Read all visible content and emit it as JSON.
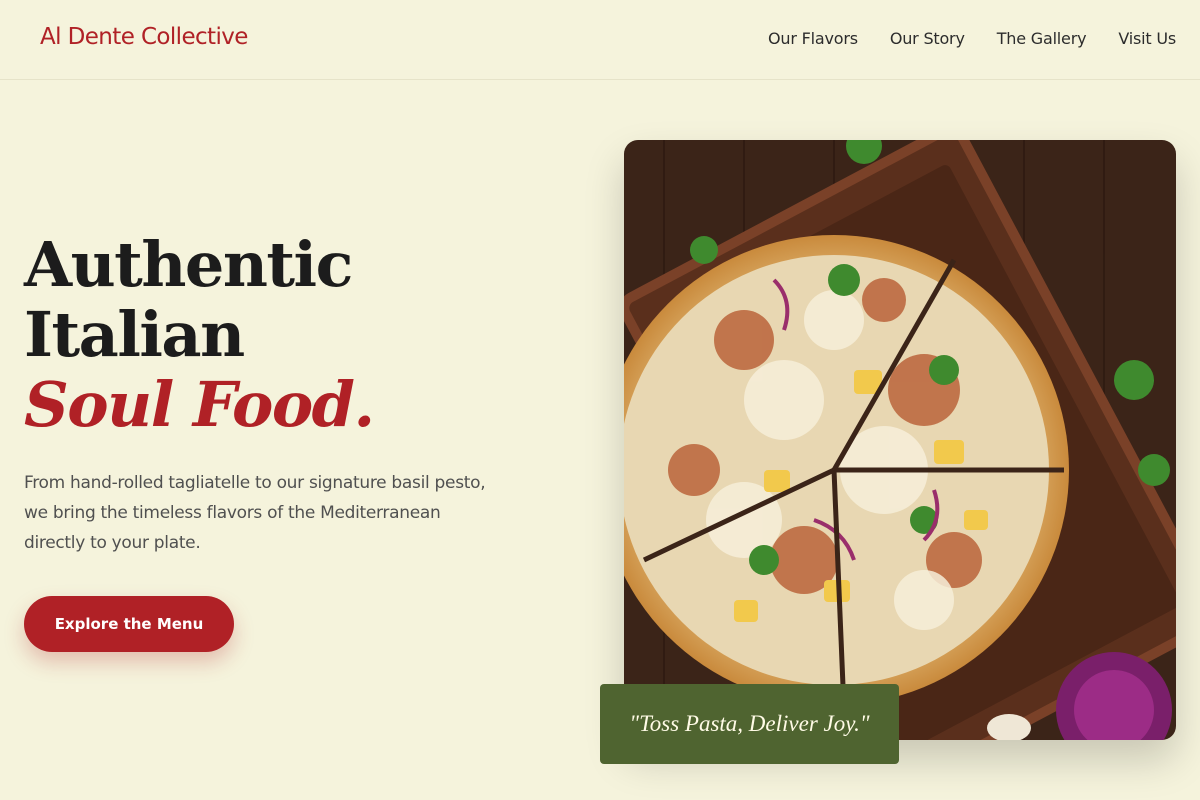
{
  "header": {
    "brand": "Al Dente Collective",
    "nav": [
      "Our Flavors",
      "Our Story",
      "The Gallery",
      "Visit Us"
    ]
  },
  "hero": {
    "title_line1": "Authentic",
    "title_line2": "Italian",
    "title_accent": "Soul Food.",
    "description": "From hand-rolled tagliatelle to our signature basil pesto, we bring the timeless flavors of the Mediterranean directly to your plate.",
    "cta_label": "Explore the Menu"
  },
  "image": {
    "subject": "pizza-photo",
    "quote": "\"Toss Pasta, Deliver Joy.\""
  },
  "colors": {
    "background": "#f5f3dc",
    "accent": "#b02126",
    "quote_box": "#4f6430"
  }
}
